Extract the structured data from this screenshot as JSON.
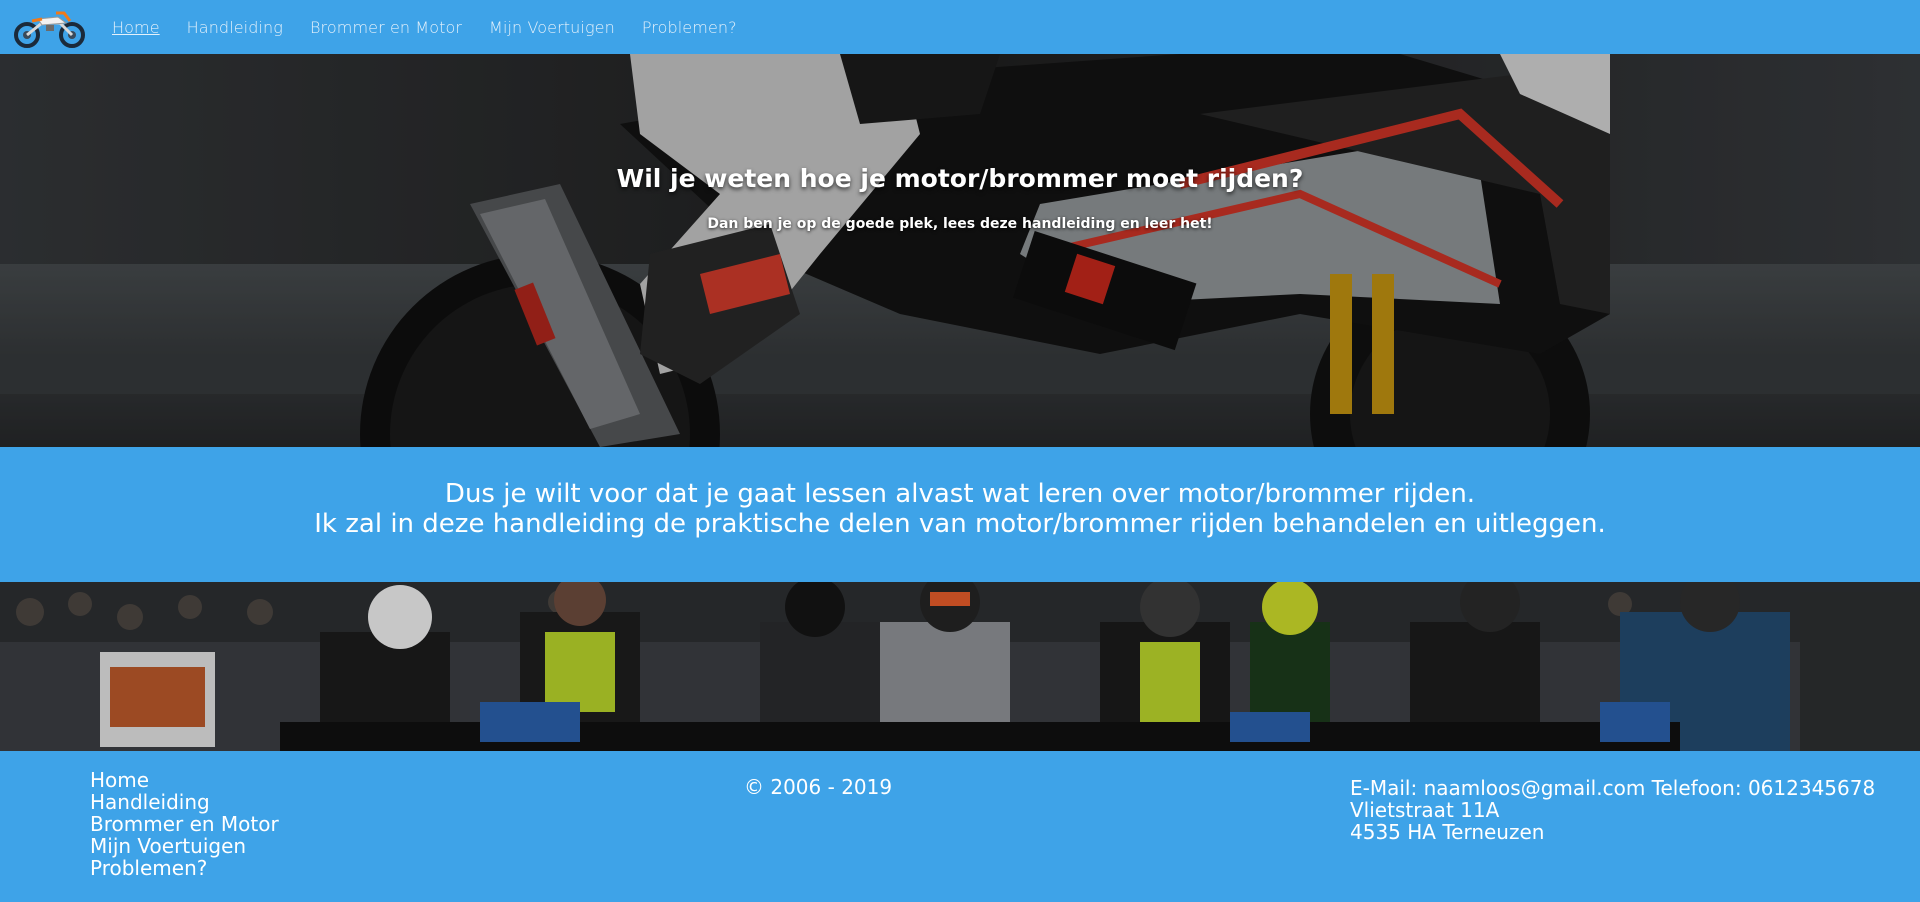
{
  "nav": {
    "items": [
      {
        "label": "Home",
        "active": true
      },
      {
        "label": "Handleiding",
        "active": false
      },
      {
        "label": "Brommer en Motor",
        "active": false
      },
      {
        "label": "Mijn Voertuigen",
        "active": false
      },
      {
        "label": "Problemen?",
        "active": false
      }
    ]
  },
  "hero": {
    "title": "Wil je weten hoe je motor/brommer moet rijden?",
    "subtitle": "Dan ben je op de goede plek, lees deze handleiding en leer het!",
    "image_icon": "racing-motorcycle-photo"
  },
  "intro": {
    "line1": "Dus je wilt voor dat je gaat lessen alvast wat leren over motor/brommer rijden.",
    "line2": "Ik zal in deze handleiding de praktische delen van motor/brommer rijden behandelen en uitleggen."
  },
  "banner": {
    "image_icon": "motorcyclists-crowd-photo"
  },
  "footer": {
    "links": [
      "Home",
      "Handleiding",
      "Brommer en Motor",
      "Mijn Voertuigen",
      "Problemen?"
    ],
    "copyright": "© 2006 - 2019",
    "contact_line1": "E-Mail: naamloos@gmail.com Telefoon: 0612345678",
    "contact_line2": "Vlietstraat 11A",
    "contact_line3": "4535 HA Terneuzen"
  },
  "colors": {
    "brand_blue": "#3ea3e8",
    "text": "#ffffff"
  }
}
